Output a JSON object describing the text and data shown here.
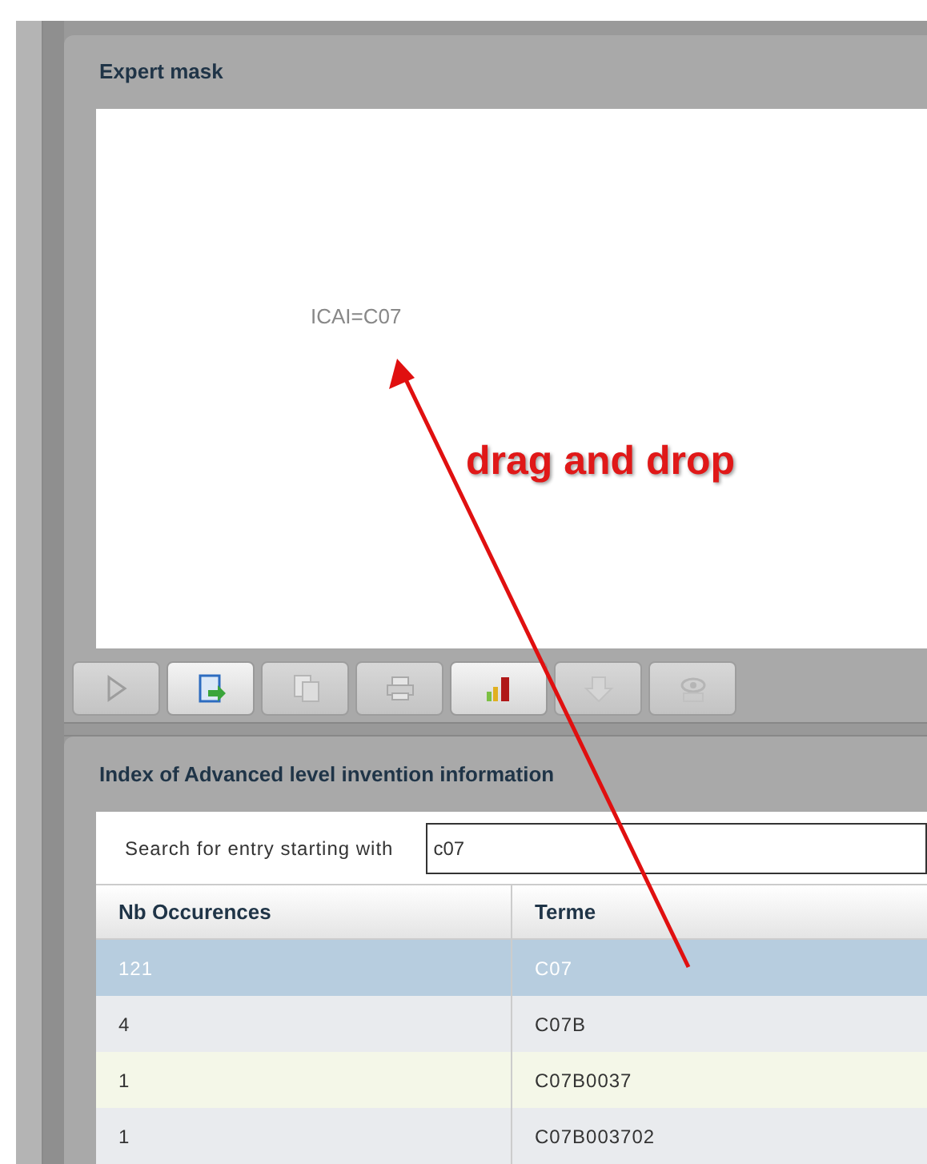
{
  "expert_mask": {
    "title": "Expert mask",
    "expression": "ICAI=C07"
  },
  "annotation": {
    "text": "drag and drop"
  },
  "toolbar": [
    {
      "kind": "play",
      "disabled": true
    },
    {
      "kind": "export",
      "disabled": false
    },
    {
      "kind": "copy",
      "disabled": true
    },
    {
      "kind": "print",
      "disabled": true
    },
    {
      "kind": "chart",
      "disabled": false
    },
    {
      "kind": "download",
      "disabled": true
    },
    {
      "kind": "preview",
      "disabled": true
    }
  ],
  "index_panel": {
    "title": "Index of Advanced level invention information",
    "search_label": "Search for entry starting with",
    "search_value": "c07",
    "columns": [
      "Nb Occurences",
      "Terme"
    ],
    "rows": [
      {
        "cells": [
          "121",
          "C07"
        ],
        "selected": true
      },
      {
        "cells": [
          "4",
          "C07B"
        ],
        "selected": false
      },
      {
        "cells": [
          "1",
          "C07B0037"
        ],
        "selected": false
      },
      {
        "cells": [
          "1",
          "C07B003702"
        ],
        "selected": false
      }
    ]
  }
}
